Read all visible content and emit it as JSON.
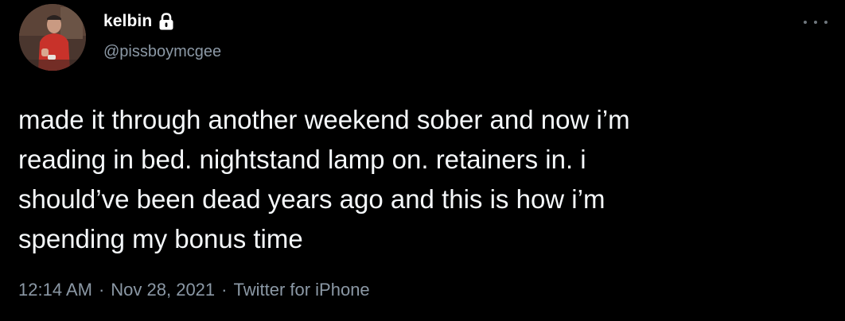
{
  "colors": {
    "background": "#000000",
    "text_primary": "#f5f8fa",
    "text_secondary": "#8b98a5"
  },
  "author": {
    "display_name": "kelbin",
    "handle": "@pissboymcgee",
    "protected_icon": "lock-icon",
    "avatar_icon": "avatar"
  },
  "menu": {
    "icon": "more-icon"
  },
  "tweet": {
    "text": "made it through another weekend sober and now i’m\nreading in bed. nightstand lamp on. retainers in. i\nshould’ve been dead years ago and this is how i’m\nspending my bonus time"
  },
  "meta": {
    "time": "12:14 AM",
    "separator": "·",
    "date": "Nov 28, 2021",
    "source": "Twitter for iPhone"
  }
}
